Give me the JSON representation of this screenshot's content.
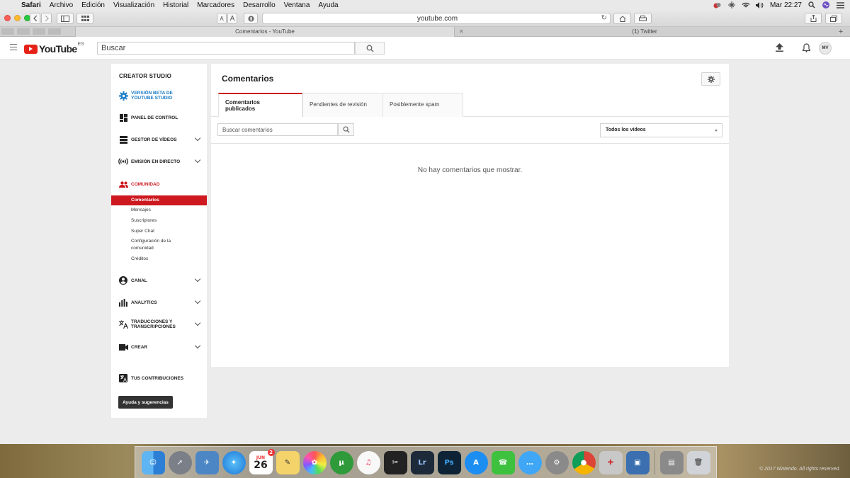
{
  "menubar": {
    "app_name": "Safari",
    "items": [
      "Archivo",
      "Edición",
      "Visualización",
      "Historial",
      "Marcadores",
      "Desarrollo",
      "Ventana",
      "Ayuda"
    ],
    "clock": "Mar 22:27"
  },
  "safari": {
    "text_small": "A",
    "text_large": "A",
    "url": "youtube.com",
    "tabs": [
      {
        "title": "Comentarios - YouTube",
        "active": true
      },
      {
        "title": "(1) Twitter",
        "active": false
      }
    ]
  },
  "youtube": {
    "logo_text": "YouTube",
    "region": "ES",
    "search_placeholder": "Buscar",
    "avatar_initials": "MV"
  },
  "sidebar": {
    "heading": "CREATOR STUDIO",
    "beta_label": "VERSIÓN BETA DE YOUTUBE STUDIO",
    "items": [
      {
        "label": "PANEL DE CONTROL"
      },
      {
        "label": "GESTOR DE VÍDEOS"
      },
      {
        "label": "EMISIÓN EN DIRECTO"
      },
      {
        "label": "COMUNIDAD"
      },
      {
        "label": "CANAL"
      },
      {
        "label": "ANALYTICS"
      },
      {
        "label": "TRADUCCIONES Y TRANSCRIPCIONES"
      },
      {
        "label": "CREAR"
      },
      {
        "label": "TUS CONTRIBUCIONES"
      }
    ],
    "community_sub": [
      "Comentarios",
      "Mensajes",
      "Suscriptores",
      "Super Chat",
      "Configuración de la comunidad",
      "Créditos"
    ],
    "help_button": "Ayuda y sugerencias"
  },
  "main": {
    "title": "Comentarios",
    "tabs": [
      "Comentarios publicados",
      "Pendientes de revisión",
      "Posiblemente spam"
    ],
    "search_placeholder": "Buscar comentarios",
    "filter_value": "Todos los vídeos",
    "empty_message": "No hay comentarios que mostrar."
  },
  "dock": {
    "calendar_month": "JUN",
    "calendar_day": "26",
    "calendar_badge": "2"
  },
  "desktop": {
    "copyright": "© 2017 Nintendo. All rights reserved."
  },
  "colors": {
    "youtube_red": "#cc181e",
    "link_blue": "#167ac6"
  }
}
